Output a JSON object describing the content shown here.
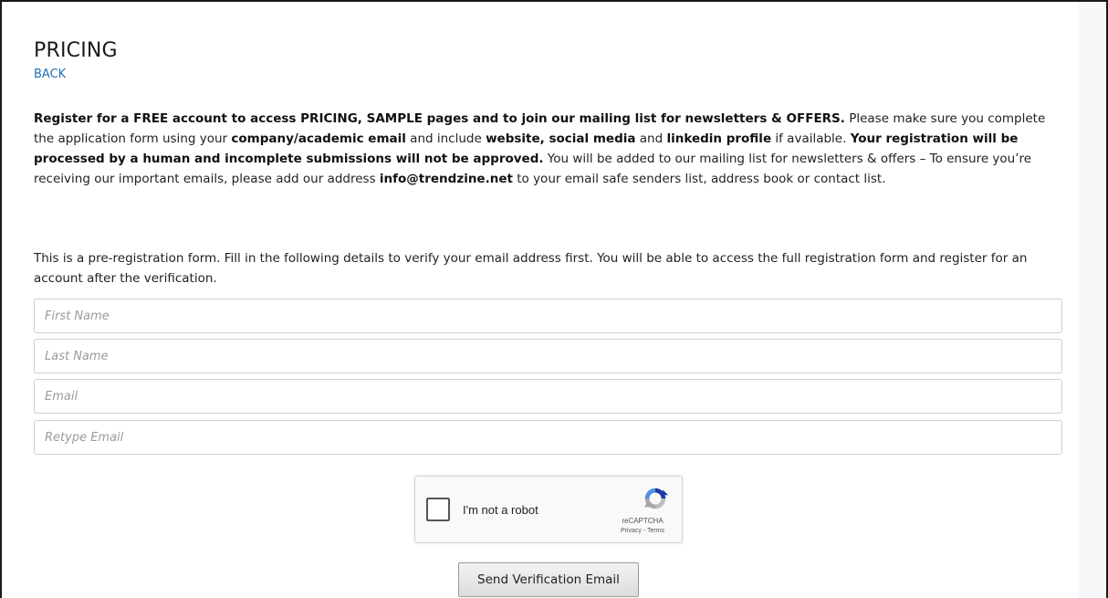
{
  "header": {
    "title": "PRICING",
    "back_label": "BACK"
  },
  "intro": {
    "p1_bold": "Register for a FREE account to access PRICING, SAMPLE pages and to join our mailing list for newsletters & OFFERS.",
    "p1_text": " Please make sure you complete the application form using your ",
    "p1_bold2": "company/academic email",
    "p1_text2": " and include ",
    "p1_bold3": "website, social media",
    "p1_text3": " and ",
    "p1_bold4": "linkedin profile",
    "p1_text4": " if available. ",
    "p1_bold5": "Your registration will be processed by a human and incomplete submissions will not be approved.",
    "p1_text5": " You will be added to our mailing list for newsletters & offers – To ensure you’re receiving our important emails, please add our address ",
    "p1_bold6": "info@trendzine.net",
    "p1_text6": "  to your email safe senders list, address book or contact list."
  },
  "prereg": {
    "text": "This is a pre-registration form. Fill in the following details to verify your email address first. You will be able to access the full registration form and register for an account after the verification."
  },
  "form": {
    "first_name_placeholder": "First Name",
    "last_name_placeholder": "Last Name",
    "email_placeholder": "Email",
    "retype_email_placeholder": "Retype Email"
  },
  "recaptcha": {
    "label": "I'm not a robot",
    "brand": "reCAPTCHA",
    "privacy": "Privacy",
    "separator": " - ",
    "terms": "Terms",
    "checked": false
  },
  "actions": {
    "send_label": "Send Verification Email"
  },
  "colors": {
    "link": "#1f6fb2",
    "border": "#cfcfcf",
    "placeholder": "#9a9a9a"
  }
}
